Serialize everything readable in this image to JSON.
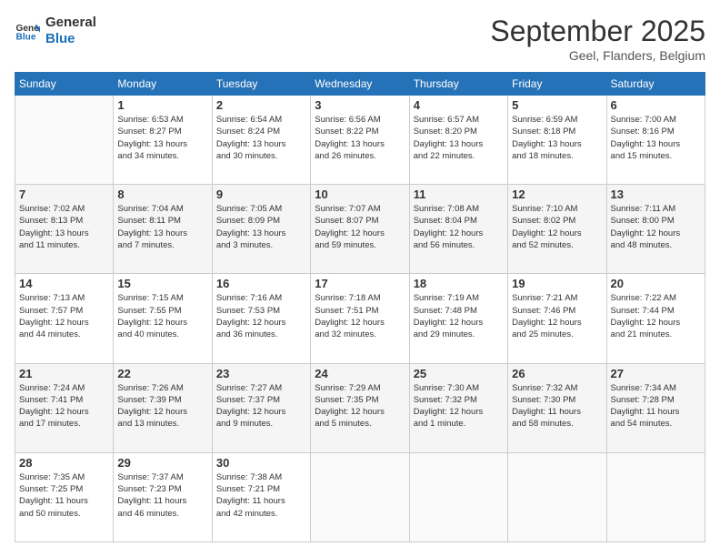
{
  "logo": {
    "line1": "General",
    "line2": "Blue"
  },
  "header": {
    "month": "September 2025",
    "location": "Geel, Flanders, Belgium"
  },
  "weekdays": [
    "Sunday",
    "Monday",
    "Tuesday",
    "Wednesday",
    "Thursday",
    "Friday",
    "Saturday"
  ],
  "weeks": [
    [
      {
        "day": "",
        "info": ""
      },
      {
        "day": "1",
        "info": "Sunrise: 6:53 AM\nSunset: 8:27 PM\nDaylight: 13 hours\nand 34 minutes."
      },
      {
        "day": "2",
        "info": "Sunrise: 6:54 AM\nSunset: 8:24 PM\nDaylight: 13 hours\nand 30 minutes."
      },
      {
        "day": "3",
        "info": "Sunrise: 6:56 AM\nSunset: 8:22 PM\nDaylight: 13 hours\nand 26 minutes."
      },
      {
        "day": "4",
        "info": "Sunrise: 6:57 AM\nSunset: 8:20 PM\nDaylight: 13 hours\nand 22 minutes."
      },
      {
        "day": "5",
        "info": "Sunrise: 6:59 AM\nSunset: 8:18 PM\nDaylight: 13 hours\nand 18 minutes."
      },
      {
        "day": "6",
        "info": "Sunrise: 7:00 AM\nSunset: 8:16 PM\nDaylight: 13 hours\nand 15 minutes."
      }
    ],
    [
      {
        "day": "7",
        "info": "Sunrise: 7:02 AM\nSunset: 8:13 PM\nDaylight: 13 hours\nand 11 minutes."
      },
      {
        "day": "8",
        "info": "Sunrise: 7:04 AM\nSunset: 8:11 PM\nDaylight: 13 hours\nand 7 minutes."
      },
      {
        "day": "9",
        "info": "Sunrise: 7:05 AM\nSunset: 8:09 PM\nDaylight: 13 hours\nand 3 minutes."
      },
      {
        "day": "10",
        "info": "Sunrise: 7:07 AM\nSunset: 8:07 PM\nDaylight: 12 hours\nand 59 minutes."
      },
      {
        "day": "11",
        "info": "Sunrise: 7:08 AM\nSunset: 8:04 PM\nDaylight: 12 hours\nand 56 minutes."
      },
      {
        "day": "12",
        "info": "Sunrise: 7:10 AM\nSunset: 8:02 PM\nDaylight: 12 hours\nand 52 minutes."
      },
      {
        "day": "13",
        "info": "Sunrise: 7:11 AM\nSunset: 8:00 PM\nDaylight: 12 hours\nand 48 minutes."
      }
    ],
    [
      {
        "day": "14",
        "info": "Sunrise: 7:13 AM\nSunset: 7:57 PM\nDaylight: 12 hours\nand 44 minutes."
      },
      {
        "day": "15",
        "info": "Sunrise: 7:15 AM\nSunset: 7:55 PM\nDaylight: 12 hours\nand 40 minutes."
      },
      {
        "day": "16",
        "info": "Sunrise: 7:16 AM\nSunset: 7:53 PM\nDaylight: 12 hours\nand 36 minutes."
      },
      {
        "day": "17",
        "info": "Sunrise: 7:18 AM\nSunset: 7:51 PM\nDaylight: 12 hours\nand 32 minutes."
      },
      {
        "day": "18",
        "info": "Sunrise: 7:19 AM\nSunset: 7:48 PM\nDaylight: 12 hours\nand 29 minutes."
      },
      {
        "day": "19",
        "info": "Sunrise: 7:21 AM\nSunset: 7:46 PM\nDaylight: 12 hours\nand 25 minutes."
      },
      {
        "day": "20",
        "info": "Sunrise: 7:22 AM\nSunset: 7:44 PM\nDaylight: 12 hours\nand 21 minutes."
      }
    ],
    [
      {
        "day": "21",
        "info": "Sunrise: 7:24 AM\nSunset: 7:41 PM\nDaylight: 12 hours\nand 17 minutes."
      },
      {
        "day": "22",
        "info": "Sunrise: 7:26 AM\nSunset: 7:39 PM\nDaylight: 12 hours\nand 13 minutes."
      },
      {
        "day": "23",
        "info": "Sunrise: 7:27 AM\nSunset: 7:37 PM\nDaylight: 12 hours\nand 9 minutes."
      },
      {
        "day": "24",
        "info": "Sunrise: 7:29 AM\nSunset: 7:35 PM\nDaylight: 12 hours\nand 5 minutes."
      },
      {
        "day": "25",
        "info": "Sunrise: 7:30 AM\nSunset: 7:32 PM\nDaylight: 12 hours\nand 1 minute."
      },
      {
        "day": "26",
        "info": "Sunrise: 7:32 AM\nSunset: 7:30 PM\nDaylight: 11 hours\nand 58 minutes."
      },
      {
        "day": "27",
        "info": "Sunrise: 7:34 AM\nSunset: 7:28 PM\nDaylight: 11 hours\nand 54 minutes."
      }
    ],
    [
      {
        "day": "28",
        "info": "Sunrise: 7:35 AM\nSunset: 7:25 PM\nDaylight: 11 hours\nand 50 minutes."
      },
      {
        "day": "29",
        "info": "Sunrise: 7:37 AM\nSunset: 7:23 PM\nDaylight: 11 hours\nand 46 minutes."
      },
      {
        "day": "30",
        "info": "Sunrise: 7:38 AM\nSunset: 7:21 PM\nDaylight: 11 hours\nand 42 minutes."
      },
      {
        "day": "",
        "info": ""
      },
      {
        "day": "",
        "info": ""
      },
      {
        "day": "",
        "info": ""
      },
      {
        "day": "",
        "info": ""
      }
    ]
  ]
}
